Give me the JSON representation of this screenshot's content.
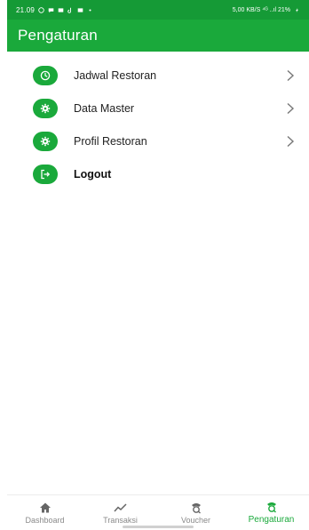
{
  "status_bar": {
    "time": "21.09",
    "right_text": "5,00 KB/S  ⁴ᴳ ..ıl  21%"
  },
  "app_bar": {
    "title": "Pengaturan"
  },
  "menu": {
    "items": [
      {
        "label": "Jadwal Restoran",
        "icon": "clock-icon",
        "chevron": true
      },
      {
        "label": "Data Master",
        "icon": "gear-icon",
        "chevron": true
      },
      {
        "label": "Profil Restoran",
        "icon": "gear-icon",
        "chevron": true
      },
      {
        "label": "Logout",
        "icon": "logout-icon",
        "chevron": false
      }
    ]
  },
  "bottom_nav": {
    "items": [
      {
        "label": "Dashboard",
        "icon": "home-icon",
        "active": false
      },
      {
        "label": "Transaksi",
        "icon": "trend-icon",
        "active": false
      },
      {
        "label": "Voucher",
        "icon": "voucher-icon",
        "active": false
      },
      {
        "label": "Pengaturan",
        "icon": "settings-voucher-icon",
        "active": true
      }
    ]
  },
  "colors": {
    "primary": "#1aa93b",
    "status_bar": "#159a36",
    "inactive_nav": "#8a8a8a"
  }
}
